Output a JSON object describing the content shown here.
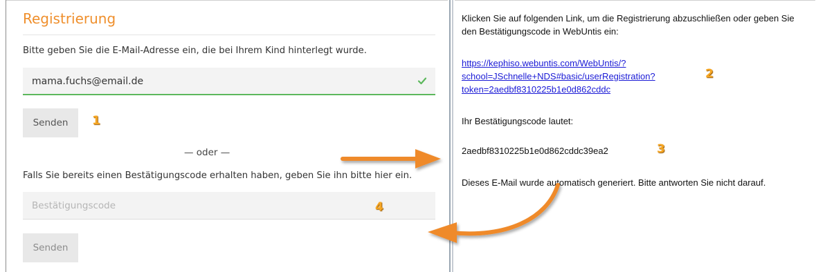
{
  "registration": {
    "title": "Registrierung",
    "instruction": "Bitte geben Sie die E-Mail-Adresse ein, die bei Ihrem Kind hinterlegt wurde.",
    "email_value": "mama.fuchs@email.de",
    "send_label": "Senden",
    "or_label": "— oder —",
    "code_info": "Falls Sie bereits einen Bestätigungscode erhalten haben, geben Sie ihn bitte hier ein.",
    "code_placeholder": "Bestätigungscode",
    "send_label_2": "Senden"
  },
  "email": {
    "intro": "Klicken Sie auf folgenden Link, um die Registrierung abzuschließen oder geben Sie den Bestätigungscode in WebUntis ein:",
    "link_line1": "https://kephiso.webuntis.com/WebUntis/?",
    "link_line2": "school=JSchnelle+NDS#basic/userRegistration?",
    "link_line3": "token=2aedbf8310225b1e0d862cddc",
    "code_label": "Ihr Bestätigungscode lautet:",
    "code": "2aedbf8310225b1e0d862cddc39ea2",
    "footer": "Dieses E-Mail wurde automatisch generiert. Bitte antworten Sie nicht darauf."
  },
  "markers": {
    "m1": "1",
    "m2": "2",
    "m3": "3",
    "m4": "4"
  },
  "colors": {
    "accent": "#ef8f2c",
    "success": "#5cb85c",
    "link": "#1a1ad6",
    "arrow": "#ef8a2a"
  }
}
